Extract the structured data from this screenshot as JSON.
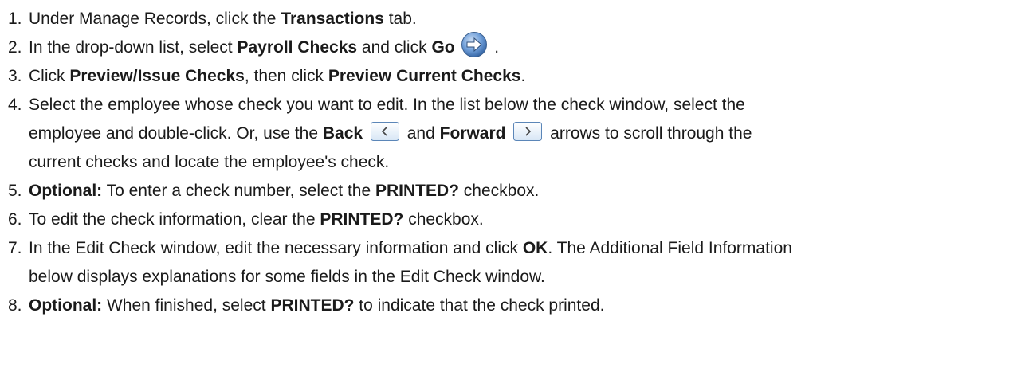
{
  "steps": [
    {
      "num": "1.",
      "parts": [
        "Under Manage Records, click the ",
        "Transactions",
        " tab."
      ]
    },
    {
      "num": "2.",
      "parts": [
        "In the drop-down list, select ",
        "Payroll Checks",
        " and click ",
        "Go",
        " ."
      ],
      "icon": "go-arrow-icon"
    },
    {
      "num": "3.",
      "parts": [
        "Click ",
        "Preview/Issue Checks",
        ", then click ",
        "Preview Current Checks",
        "."
      ]
    },
    {
      "num": "4.",
      "lines": [
        "Select the employee whose check you want to edit. In the list below the check window, select the",
        [
          "employee and double-click. Or, use the ",
          "Back",
          " and ",
          "Forward",
          " arrows to scroll through the"
        ],
        "current checks and locate the employee's check."
      ],
      "icons": [
        "back-arrow-icon",
        "forward-arrow-icon"
      ]
    },
    {
      "num": "5.",
      "parts": [
        "Optional:",
        " To enter a check number, select the ",
        "PRINTED?",
        " checkbox."
      ]
    },
    {
      "num": "6.",
      "parts": [
        "To edit the check information, clear the ",
        "PRINTED?",
        " checkbox."
      ]
    },
    {
      "num": "7.",
      "lines": [
        [
          "In the Edit Check window, edit the necessary information and click ",
          "OK",
          ". The Additional Field Information"
        ],
        "below displays explanations for some fields in the Edit Check window."
      ]
    },
    {
      "num": "8.",
      "parts": [
        "Optional:",
        " When finished, select ",
        "PRINTED?",
        " to indicate that the check printed."
      ]
    }
  ]
}
